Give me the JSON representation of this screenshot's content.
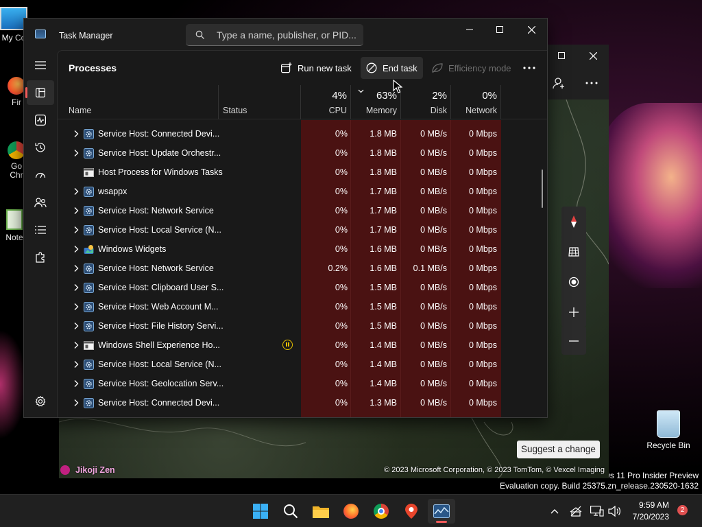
{
  "desktop": {
    "icons": [
      {
        "label": "My Co"
      },
      {
        "label": "Fir"
      },
      {
        "label": "Go Chr"
      },
      {
        "label": "Note"
      },
      {
        "label": "Recycle Bin"
      }
    ],
    "watermark_line1": "ws 11 Pro Insider Preview",
    "watermark_line2": "Evaluation copy. Build 25375.zn_release.230520-1632"
  },
  "maps": {
    "suggest_label": "Suggest a change",
    "place_label": "Jikoji Zen",
    "copyright": "© 2023 Microsoft Corporation, © 2023 TomTom, © Vexcel Imaging"
  },
  "task_manager": {
    "title": "Task Manager",
    "search_placeholder": "Type a name, publisher, or PID...",
    "page_title": "Processes",
    "commands": {
      "run_new_task": "Run new task",
      "end_task": "End task",
      "efficiency_mode": "Efficiency mode"
    },
    "columns": {
      "name": "Name",
      "status": "Status",
      "cpu": {
        "pct": "4%",
        "label": "CPU"
      },
      "memory": {
        "pct": "63%",
        "label": "Memory"
      },
      "disk": {
        "pct": "2%",
        "label": "Disk"
      },
      "network": {
        "pct": "0%",
        "label": "Network"
      }
    },
    "heat_color": "#4a1212",
    "processes": [
      {
        "name": "Service Host: Connected Devi...",
        "expandable": true,
        "icon": "gear-icon",
        "status": "",
        "cpu": "0%",
        "memory": "1.8 MB",
        "disk": "0 MB/s",
        "network": "0 Mbps"
      },
      {
        "name": "Service Host: Update Orchestr...",
        "expandable": true,
        "icon": "gear-icon",
        "status": "",
        "cpu": "0%",
        "memory": "1.8 MB",
        "disk": "0 MB/s",
        "network": "0 Mbps"
      },
      {
        "name": "Host Process for Windows Tasks",
        "expandable": false,
        "icon": "window-icon",
        "status": "",
        "cpu": "0%",
        "memory": "1.8 MB",
        "disk": "0 MB/s",
        "network": "0 Mbps"
      },
      {
        "name": "wsappx",
        "expandable": true,
        "icon": "gear-icon",
        "status": "",
        "cpu": "0%",
        "memory": "1.7 MB",
        "disk": "0 MB/s",
        "network": "0 Mbps"
      },
      {
        "name": "Service Host: Network Service",
        "expandable": true,
        "icon": "gear-icon",
        "status": "",
        "cpu": "0%",
        "memory": "1.7 MB",
        "disk": "0 MB/s",
        "network": "0 Mbps"
      },
      {
        "name": "Service Host: Local Service (N...",
        "expandable": true,
        "icon": "gear-icon",
        "status": "",
        "cpu": "0%",
        "memory": "1.7 MB",
        "disk": "0 MB/s",
        "network": "0 Mbps"
      },
      {
        "name": "Windows Widgets",
        "expandable": true,
        "icon": "widgets-icon",
        "status": "",
        "cpu": "0%",
        "memory": "1.6 MB",
        "disk": "0 MB/s",
        "network": "0 Mbps"
      },
      {
        "name": "Service Host: Network Service",
        "expandable": true,
        "icon": "gear-icon",
        "status": "",
        "cpu": "0.2%",
        "memory": "1.6 MB",
        "disk": "0.1 MB/s",
        "network": "0 Mbps"
      },
      {
        "name": "Service Host: Clipboard User S...",
        "expandable": true,
        "icon": "gear-icon",
        "status": "",
        "cpu": "0%",
        "memory": "1.5 MB",
        "disk": "0 MB/s",
        "network": "0 Mbps"
      },
      {
        "name": "Service Host: Web Account M...",
        "expandable": true,
        "icon": "gear-icon",
        "status": "",
        "cpu": "0%",
        "memory": "1.5 MB",
        "disk": "0 MB/s",
        "network": "0 Mbps"
      },
      {
        "name": "Service Host: File History Servi...",
        "expandable": true,
        "icon": "gear-icon",
        "status": "",
        "cpu": "0%",
        "memory": "1.5 MB",
        "disk": "0 MB/s",
        "network": "0 Mbps"
      },
      {
        "name": "Windows Shell Experience Ho...",
        "expandable": true,
        "icon": "window-icon",
        "status": "suspended",
        "cpu": "0%",
        "memory": "1.4 MB",
        "disk": "0 MB/s",
        "network": "0 Mbps"
      },
      {
        "name": "Service Host: Local Service (N...",
        "expandable": true,
        "icon": "gear-icon",
        "status": "",
        "cpu": "0%",
        "memory": "1.4 MB",
        "disk": "0 MB/s",
        "network": "0 Mbps"
      },
      {
        "name": "Service Host: Geolocation Serv...",
        "expandable": true,
        "icon": "gear-icon",
        "status": "",
        "cpu": "0%",
        "memory": "1.4 MB",
        "disk": "0 MB/s",
        "network": "0 Mbps"
      },
      {
        "name": "Service Host: Connected Devi...",
        "expandable": true,
        "icon": "gear-icon",
        "status": "",
        "cpu": "0%",
        "memory": "1.3 MB",
        "disk": "0 MB/s",
        "network": "0 Mbps"
      }
    ]
  },
  "taskbar": {
    "time": "9:59 AM",
    "date": "7/20/2023",
    "notification_count": "2"
  }
}
